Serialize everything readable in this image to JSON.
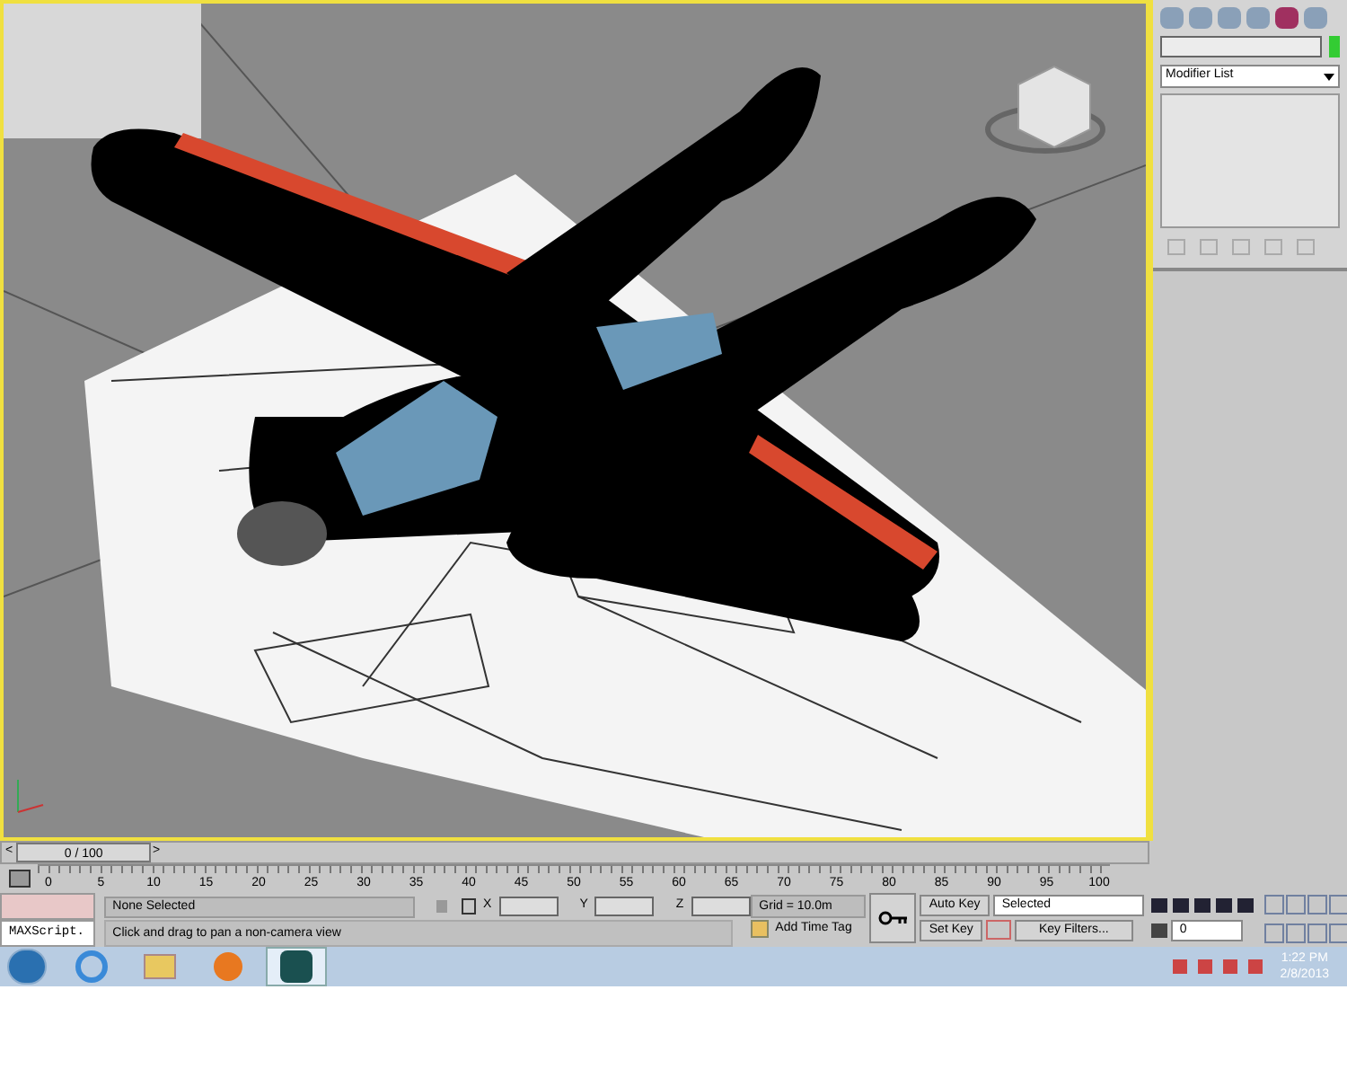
{
  "command_panel": {
    "modifier_list": "Modifier List"
  },
  "time_slider": {
    "label": "0 / 100",
    "level": 0,
    "prev": "<",
    "next": ">"
  },
  "track_bar": {
    "ticks": [
      "0",
      "5",
      "10",
      "15",
      "20",
      "25",
      "30",
      "35",
      "40",
      "45",
      "50",
      "55",
      "60",
      "65",
      "70",
      "75",
      "80",
      "85",
      "90",
      "95",
      "100"
    ]
  },
  "status_bar": {
    "maxscript": "MAXScript.",
    "selection": "None Selected",
    "prompt": "Click and drag to pan a non-camera view",
    "x_label": "X",
    "y_label": "Y",
    "z_label": "Z",
    "grid": "Grid = 10.0m",
    "add_time_tag": "Add Time Tag"
  },
  "animation": {
    "auto_key": "Auto Key",
    "set_key": "Set Key",
    "key_mode": "Selected",
    "key_filters": "Key Filters...",
    "frame": "0"
  },
  "taskbar": {
    "apps": [
      {
        "kind": "browser",
        "selected": false
      },
      {
        "kind": "folder",
        "selected": false
      },
      {
        "kind": "media",
        "selected": false
      },
      {
        "kind": "max",
        "selected": true
      }
    ],
    "time": "1:22 PM",
    "date": "2/8/2013"
  }
}
